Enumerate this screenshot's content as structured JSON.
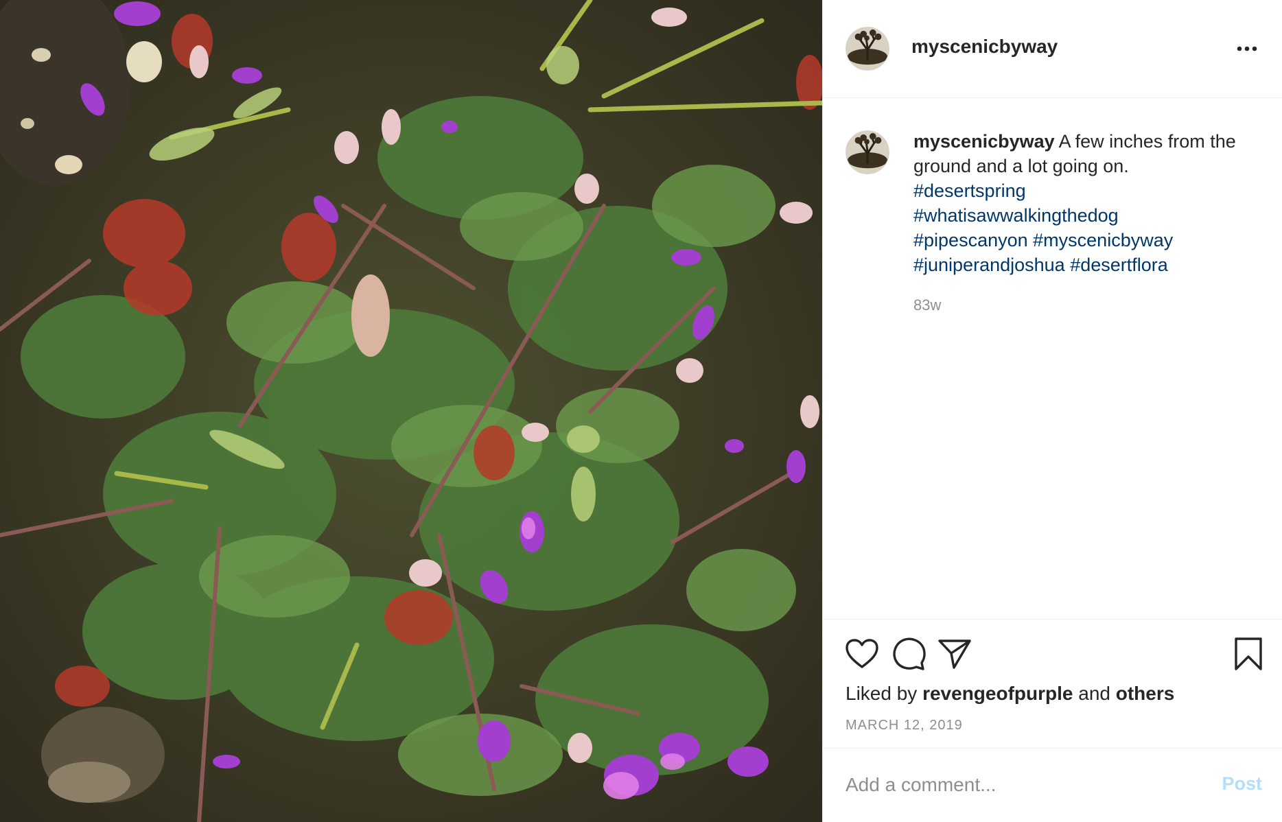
{
  "post": {
    "author": {
      "username": "myscenicbyway"
    },
    "caption": {
      "username": "myscenicbyway",
      "text": "A few inches from the ground and a lot going on.",
      "hashtags": [
        "#desertspring",
        "#whatisawwalkingthedog",
        "#pipescanyon",
        "#myscenicbyway",
        "#juniperandjoshua",
        "#desertflora"
      ],
      "time_ago": "83w"
    },
    "likes": {
      "prefix": "Liked by",
      "user": "revengeofpurple",
      "middle": "and",
      "others": "others"
    },
    "date": "MARCH 12, 2019",
    "comment": {
      "placeholder": "Add a comment...",
      "post_label": "Post"
    },
    "icons": {
      "more": "more-options-icon",
      "like": "heart-icon",
      "comment": "comment-icon",
      "share": "share-icon",
      "save": "bookmark-icon"
    },
    "colors": {
      "hashtag": "#00376b",
      "muted_text": "#8e8e8e",
      "post_button_disabled": "#b2dffc",
      "border": "#efefef"
    }
  }
}
